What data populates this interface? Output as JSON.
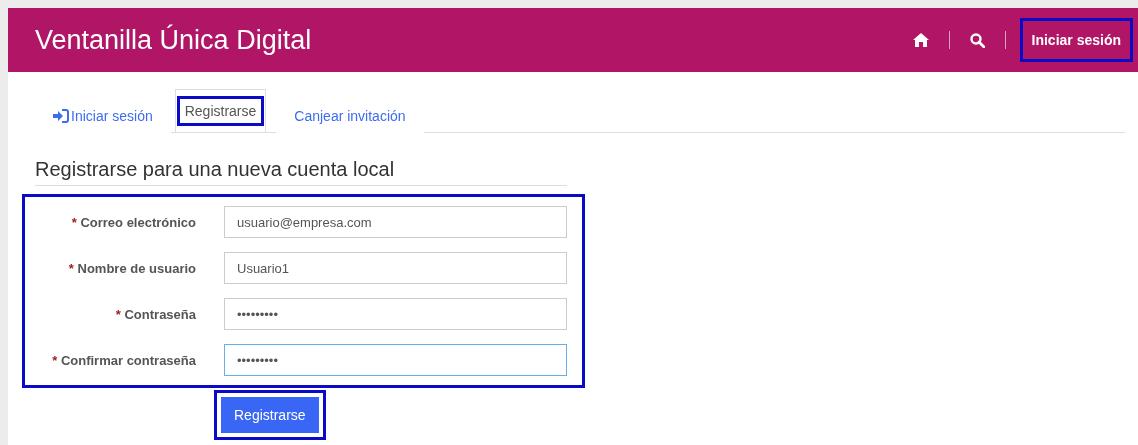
{
  "header": {
    "title": "Ventanilla Única Digital",
    "nav": [
      {
        "kind": "home"
      },
      {
        "kind": "search"
      },
      {
        "kind": "link",
        "label": "Iniciar sesión",
        "highlighted": true
      }
    ]
  },
  "tabs": [
    {
      "label": "Iniciar sesión",
      "selected": false,
      "highlighted": false
    },
    {
      "label": "Registrarse",
      "selected": true,
      "highlighted": true
    },
    {
      "label": "Canjear invitación",
      "selected": false,
      "highlighted": false
    }
  ],
  "form": {
    "heading": "Registrarse para una nueva cuenta local",
    "highlighted": true,
    "fields": [
      {
        "marker": "*",
        "label": "Correo electrónico",
        "value": "usuario@empresa.com",
        "focused": false
      },
      {
        "marker": "*",
        "label": "Nombre de usuario",
        "value": "Usuario1",
        "focused": false
      },
      {
        "marker": "*",
        "label": "Contraseña",
        "value": "•••••••••",
        "focused": false
      },
      {
        "marker": "*",
        "label": "Confirmar contraseña",
        "value": "•••••••••",
        "focused": true
      }
    ],
    "submit": {
      "label": "Registrarse",
      "highlighted": true
    }
  }
}
